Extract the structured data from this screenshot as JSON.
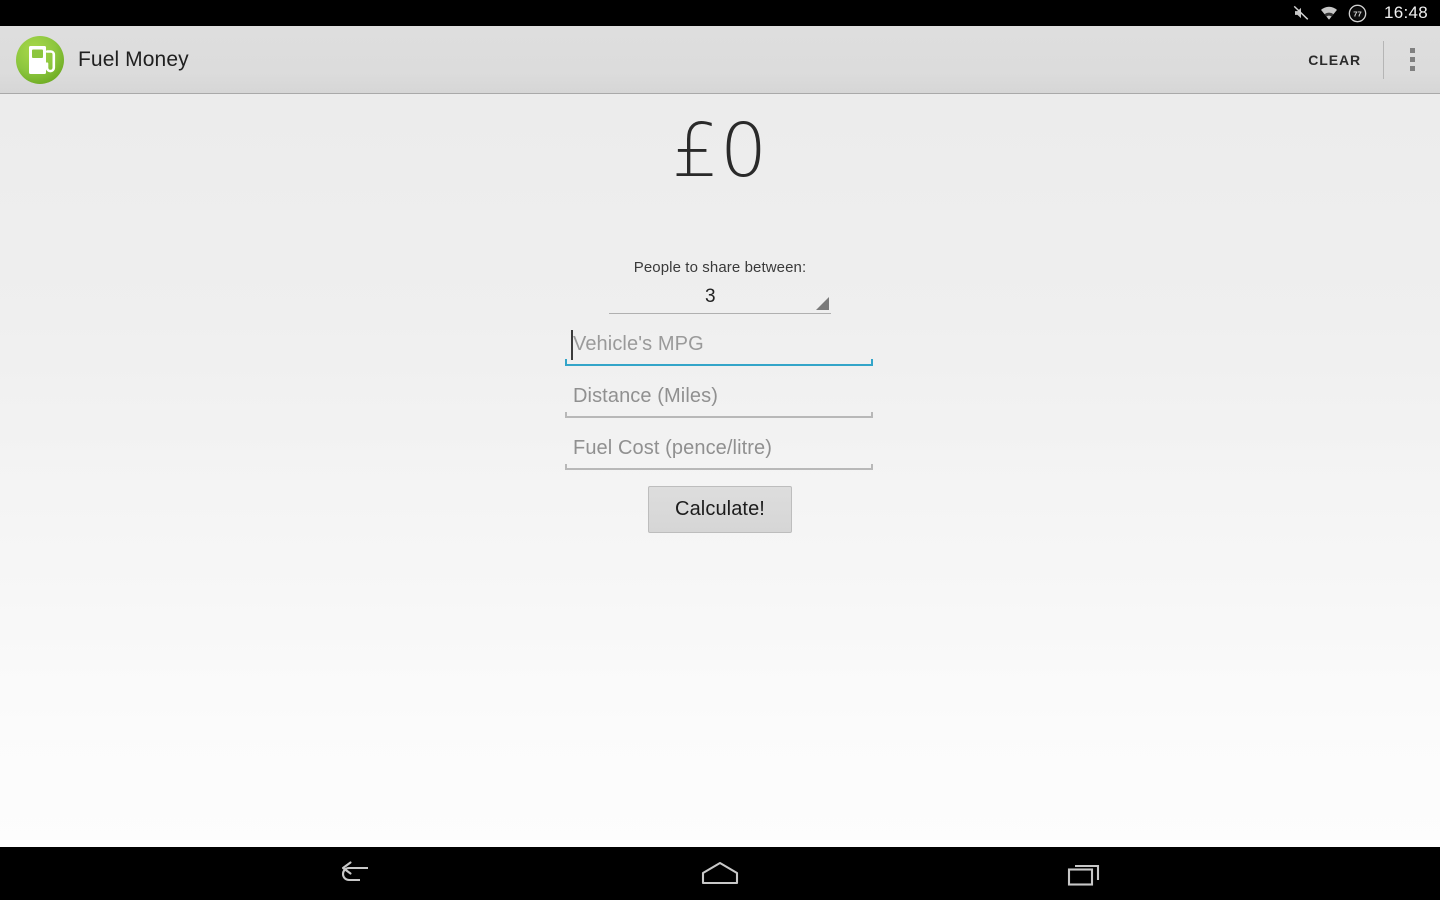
{
  "status_bar": {
    "icons": [
      "mute-icon",
      "wifi-icon",
      "battery-icon"
    ],
    "battery_level": "77",
    "time": "16:48"
  },
  "action_bar": {
    "app_icon": "fuel-pump-icon",
    "title": "Fuel Money",
    "clear_label": "CLEAR",
    "overflow_icon": "overflow-menu-icon"
  },
  "main": {
    "amount": "£0",
    "share_label": "People to share between:",
    "spinner": {
      "value": "3",
      "arrow_icon": "dropdown-triangle-icon"
    },
    "fields": [
      {
        "name": "mpg",
        "placeholder": "Vehicle's MPG",
        "value": "",
        "focused": true
      },
      {
        "name": "distance",
        "placeholder": "Distance (Miles)",
        "value": "",
        "focused": false
      },
      {
        "name": "fuel-cost",
        "placeholder": "Fuel Cost (pence/litre)",
        "value": "",
        "focused": false
      }
    ],
    "calculate_label": "Calculate!"
  },
  "nav_bar": {
    "back": "back-icon",
    "home": "home-icon",
    "recents": "recent-apps-icon"
  },
  "colors": {
    "accent_blue": "#33a5c9",
    "brand_green": "#8cc63e",
    "action_bar": "#dcdcdc"
  }
}
